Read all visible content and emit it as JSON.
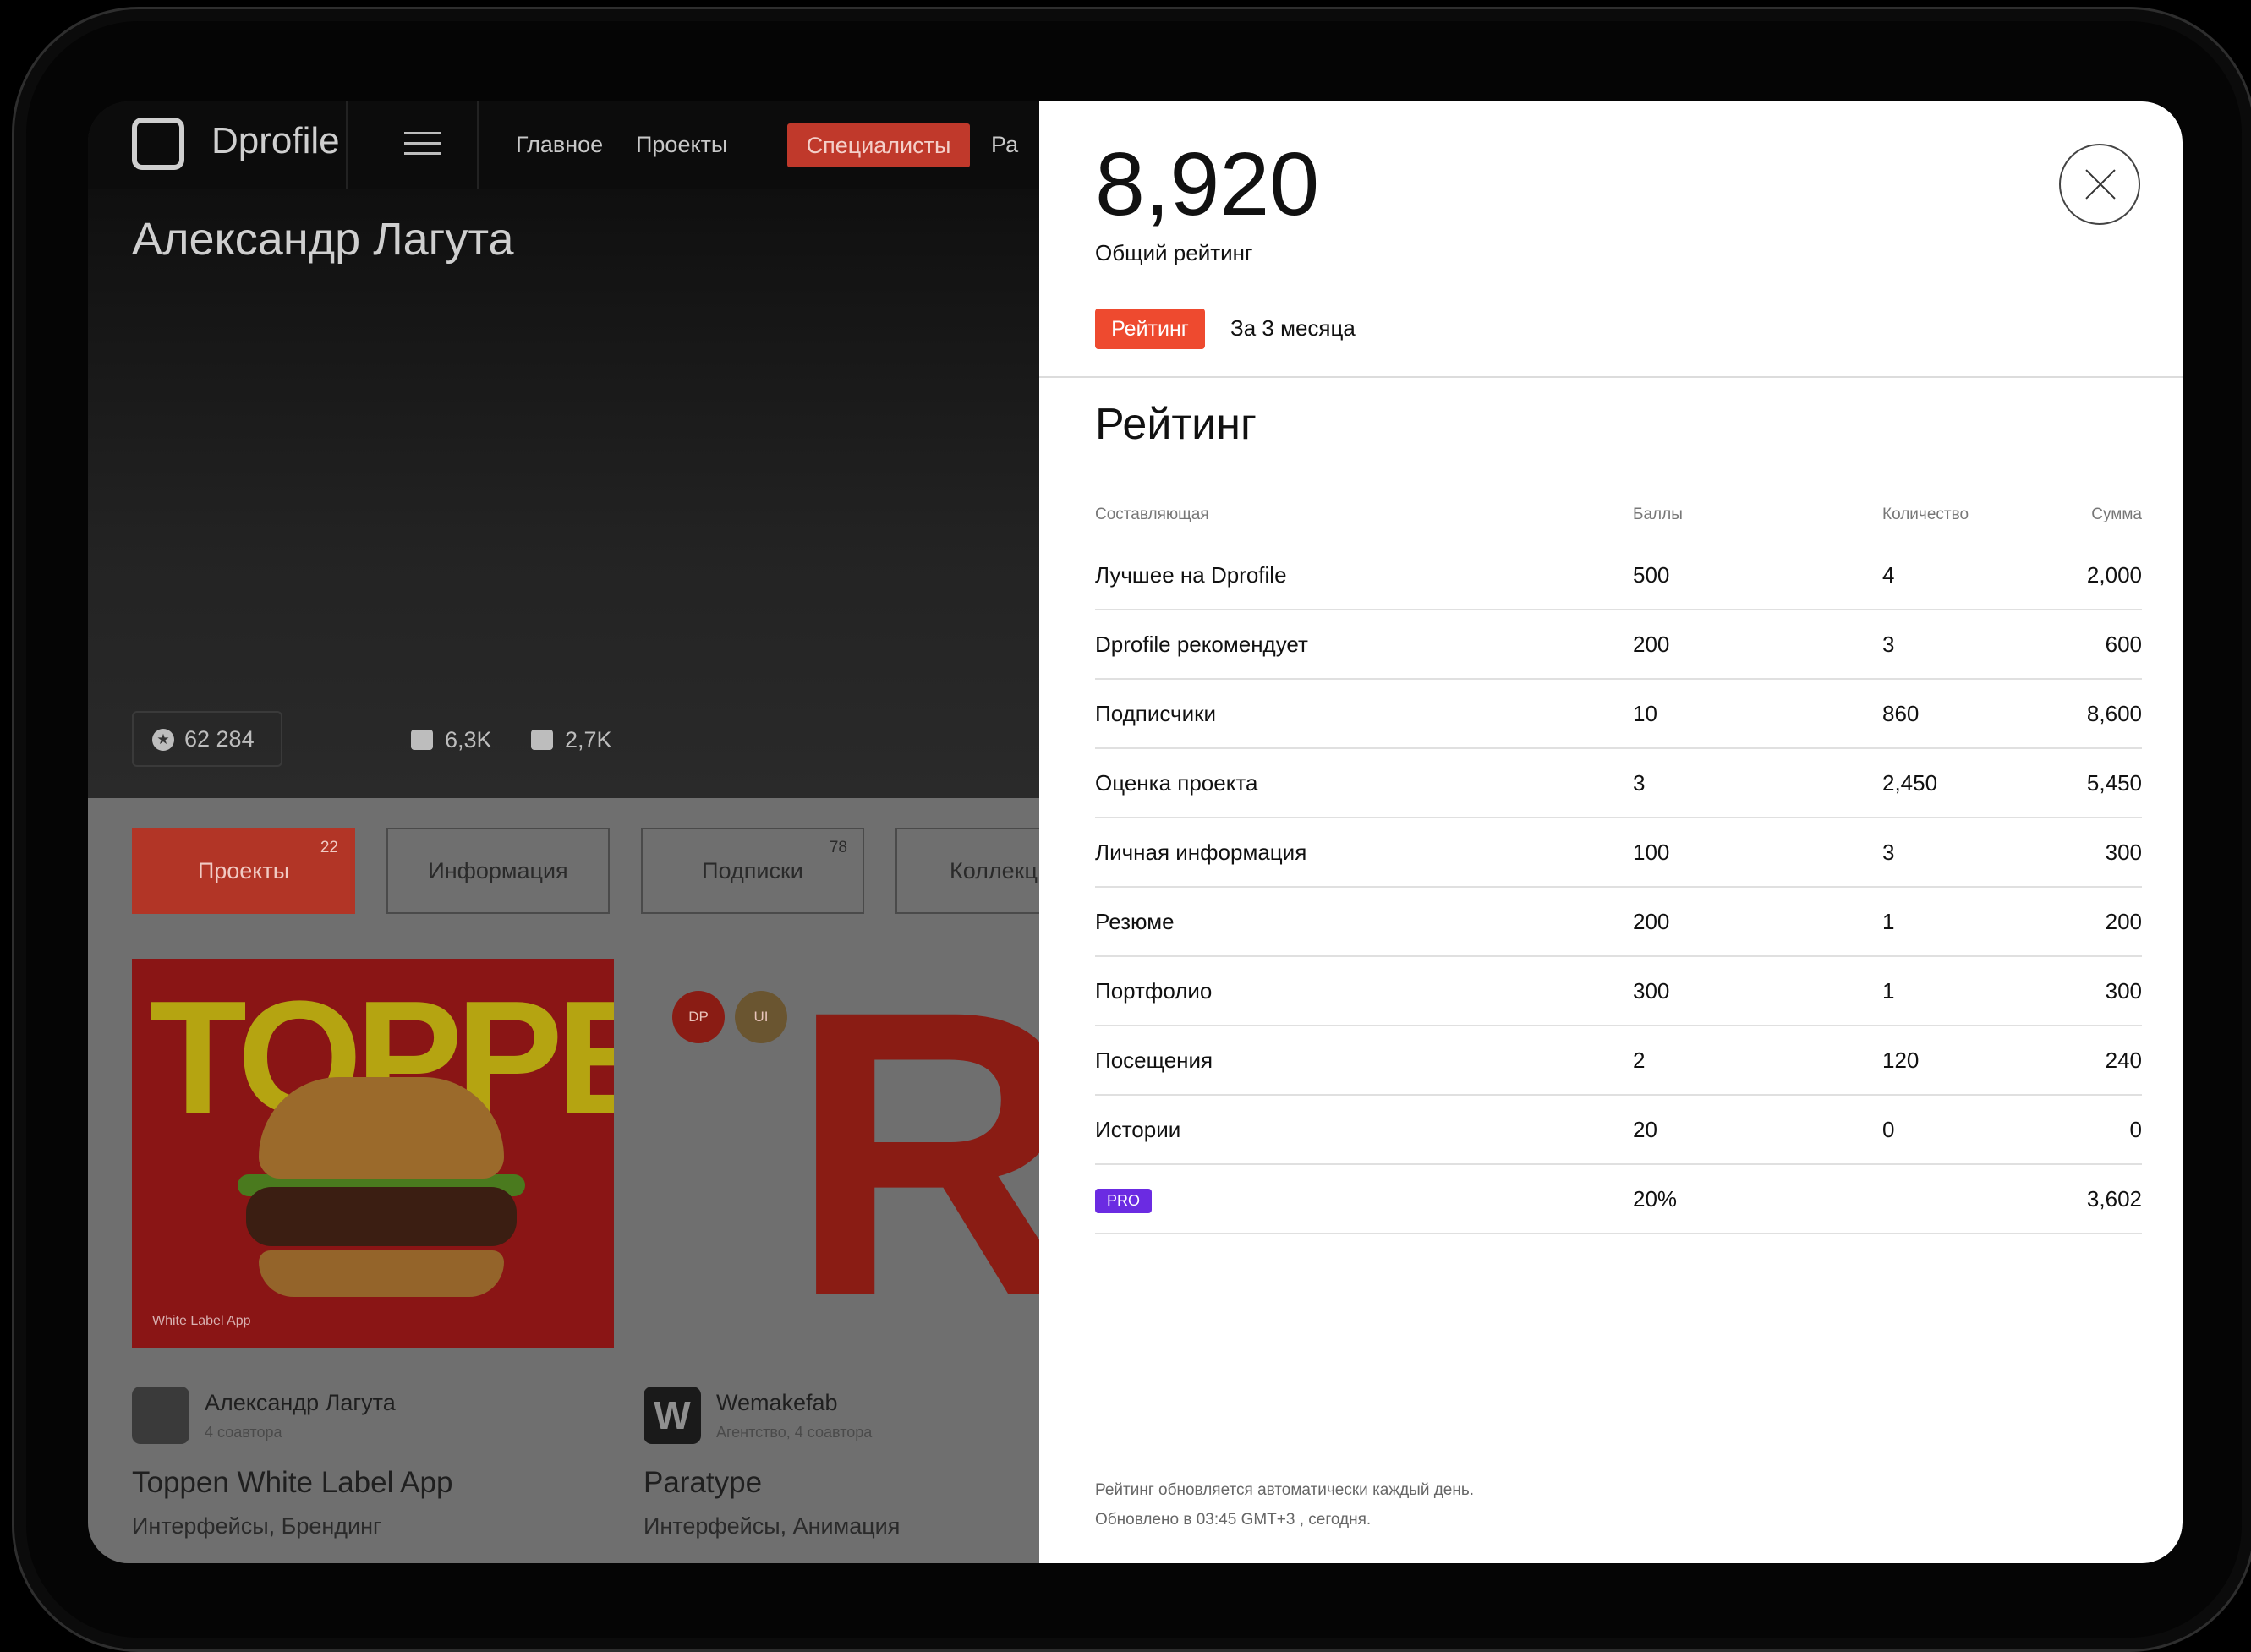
{
  "header": {
    "logo": "Dprofile",
    "nav": [
      "Главное",
      "Проекты",
      "Специалисты",
      "Ра"
    ]
  },
  "profile": {
    "name": "Александр Лагута",
    "rating_pill": "62 284",
    "likes": "6,3K",
    "followers": "2,7K"
  },
  "tabs": [
    {
      "label": "Проекты",
      "count": "22"
    },
    {
      "label": "Информация",
      "count": ""
    },
    {
      "label": "Подписки",
      "count": "78"
    },
    {
      "label": "Коллекц",
      "count": ""
    }
  ],
  "cards": [
    {
      "image_text": "TOPPEN",
      "caption": "White Label App",
      "author": "Александр Лагута",
      "author_sub": "4 соавтора",
      "title": "Toppen White Label App",
      "tags": "Интерфейсы, Брендинг"
    },
    {
      "image_text": "R",
      "badges": [
        "DP",
        "UI"
      ],
      "author_avatar": "W",
      "author": "Wemakefab",
      "author_sub": "Агентство, 4 соавтора",
      "title": "Paratype",
      "tags": "Интерфейсы, Анимация"
    }
  ],
  "modal": {
    "total": "8,920",
    "total_label": "Общий рейтинг",
    "tab_active": "Рейтинг",
    "tab_other": "За 3 месяца",
    "section_title": "Рейтинг",
    "columns": [
      "Составляющая",
      "Баллы",
      "Количество",
      "Сумма"
    ],
    "rows": [
      {
        "name": "Лучшее на Dprofile",
        "points": "500",
        "count": "4",
        "sum": "2,000"
      },
      {
        "name": "Dprofile рекомендует",
        "points": "200",
        "count": "3",
        "sum": "600"
      },
      {
        "name": "Подписчики",
        "points": "10",
        "count": "860",
        "sum": "8,600"
      },
      {
        "name": "Оценка проекта",
        "points": "3",
        "count": "2,450",
        "sum": "5,450"
      },
      {
        "name": "Личная информация",
        "points": "100",
        "count": "3",
        "sum": "300"
      },
      {
        "name": "Резюме",
        "points": "200",
        "count": "1",
        "sum": "200"
      },
      {
        "name": "Портфолио",
        "points": "300",
        "count": "1",
        "sum": "300"
      },
      {
        "name": "Посещения",
        "points": "2",
        "count": "120",
        "sum": "240"
      },
      {
        "name": "Истории",
        "points": "20",
        "count": "0",
        "sum": "0"
      },
      {
        "name": "PRO",
        "points": "20%",
        "count": "",
        "sum": "3,602"
      }
    ],
    "footer_line1": "Рейтинг обновляется автоматически каждый день.",
    "footer_line2": "Обновлено в 03:45 GMT+3 , сегодня."
  },
  "colors": {
    "accent": "#ee4a2f",
    "pro": "#6b2be2"
  }
}
